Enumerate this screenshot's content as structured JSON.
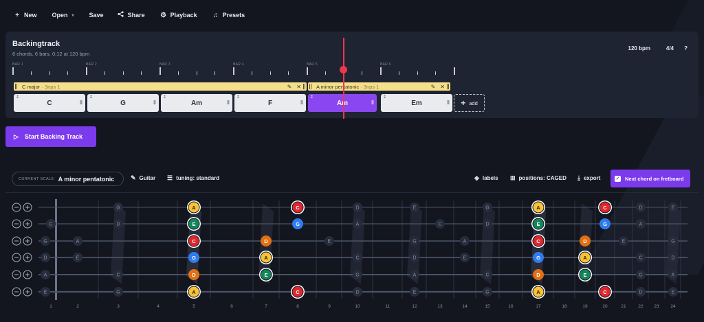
{
  "toolbar": {
    "new": "New",
    "open": "Open",
    "save": "Save",
    "share": "Share",
    "playback": "Playback",
    "presets": "Presets"
  },
  "backing_track": {
    "title": "Backingtrack",
    "subtitle": "6 chords, 6 bars, 0:12 at 120 bpm",
    "bpm": "120 bpm",
    "time_signature": "4/4",
    "help": "?",
    "bar_labels": [
      "BAR 1",
      "BAR 2",
      "BAR 3",
      "BAR 4",
      "BAR 5",
      "BAR 6"
    ],
    "scales": [
      {
        "name": "C major",
        "detail": "· 3nps 1"
      },
      {
        "name": "A minor pentatonic",
        "detail": "· 3nps 1"
      }
    ],
    "chords": [
      "C",
      "G",
      "Am",
      "F",
      "Am",
      "Em"
    ],
    "active_chord_index": 4,
    "add_label": "add"
  },
  "start_button": "Start Backing Track",
  "scale_toolbar": {
    "current_scale_label": "CURRENT SCALE",
    "current_scale": "A minor pentatonic",
    "instrument": "Guitar",
    "tuning": "tuning: standard",
    "labels": "labels",
    "positions": "positions: CAGED",
    "export": "export",
    "next_chord": "Next chord on fretboard"
  },
  "fretboard": {
    "open_strings": [
      "E",
      "B",
      "G",
      "D",
      "A",
      "E"
    ],
    "fret_numbers": [
      "1",
      "2",
      "3",
      "4",
      "5",
      "6",
      "7",
      "8",
      "9",
      "10",
      "11",
      "12",
      "13",
      "14",
      "15",
      "16",
      "17",
      "18",
      "19",
      "20",
      "21",
      "22",
      "23",
      "24"
    ],
    "note_colors": {
      "A": "#f7c236",
      "C": "#e0262f",
      "D": "#e36f13",
      "E": "#13855a",
      "G": "#2f7cf0"
    },
    "notes": [
      {
        "s": 0,
        "f": 3,
        "n": "G",
        "t": "ghost"
      },
      {
        "s": 0,
        "f": 5,
        "n": "A",
        "t": "root"
      },
      {
        "s": 0,
        "f": 8,
        "n": "C",
        "t": "root"
      },
      {
        "s": 0,
        "f": 10,
        "n": "D",
        "t": "ghost"
      },
      {
        "s": 0,
        "f": 12,
        "n": "E",
        "t": "ghost"
      },
      {
        "s": 0,
        "f": 15,
        "n": "G",
        "t": "ghost"
      },
      {
        "s": 0,
        "f": 17,
        "n": "A",
        "t": "root"
      },
      {
        "s": 0,
        "f": 20,
        "n": "C",
        "t": "root"
      },
      {
        "s": 0,
        "f": 22,
        "n": "D",
        "t": "ghost"
      },
      {
        "s": 0,
        "f": 24,
        "n": "E",
        "t": "ghost"
      },
      {
        "s": 1,
        "f": 1,
        "n": "C",
        "t": "ghost"
      },
      {
        "s": 1,
        "f": 3,
        "n": "D",
        "t": "ghost"
      },
      {
        "s": 1,
        "f": 5,
        "n": "E",
        "t": "root"
      },
      {
        "s": 1,
        "f": 8,
        "n": "G",
        "t": "note"
      },
      {
        "s": 1,
        "f": 10,
        "n": "A",
        "t": "ghost"
      },
      {
        "s": 1,
        "f": 13,
        "n": "C",
        "t": "ghost"
      },
      {
        "s": 1,
        "f": 15,
        "n": "D",
        "t": "ghost"
      },
      {
        "s": 1,
        "f": 17,
        "n": "E",
        "t": "root"
      },
      {
        "s": 1,
        "f": 20,
        "n": "G",
        "t": "note"
      },
      {
        "s": 1,
        "f": 22,
        "n": "A",
        "t": "ghost"
      },
      {
        "s": 2,
        "f": 0,
        "n": "G",
        "t": "ghost"
      },
      {
        "s": 2,
        "f": 2,
        "n": "A",
        "t": "ghost"
      },
      {
        "s": 2,
        "f": 5,
        "n": "C",
        "t": "root"
      },
      {
        "s": 2,
        "f": 7,
        "n": "D",
        "t": "note"
      },
      {
        "s": 2,
        "f": 9,
        "n": "E",
        "t": "ghost"
      },
      {
        "s": 2,
        "f": 12,
        "n": "G",
        "t": "ghost"
      },
      {
        "s": 2,
        "f": 14,
        "n": "A",
        "t": "ghost"
      },
      {
        "s": 2,
        "f": 17,
        "n": "C",
        "t": "root"
      },
      {
        "s": 2,
        "f": 19,
        "n": "D",
        "t": "note"
      },
      {
        "s": 2,
        "f": 21,
        "n": "E",
        "t": "ghost"
      },
      {
        "s": 2,
        "f": 24,
        "n": "G",
        "t": "ghost"
      },
      {
        "s": 3,
        "f": 0,
        "n": "D",
        "t": "ghost"
      },
      {
        "s": 3,
        "f": 2,
        "n": "E",
        "t": "ghost"
      },
      {
        "s": 3,
        "f": 5,
        "n": "G",
        "t": "note"
      },
      {
        "s": 3,
        "f": 7,
        "n": "A",
        "t": "root"
      },
      {
        "s": 3,
        "f": 10,
        "n": "C",
        "t": "ghost"
      },
      {
        "s": 3,
        "f": 12,
        "n": "D",
        "t": "ghost"
      },
      {
        "s": 3,
        "f": 14,
        "n": "E",
        "t": "ghost"
      },
      {
        "s": 3,
        "f": 17,
        "n": "G",
        "t": "note"
      },
      {
        "s": 3,
        "f": 19,
        "n": "A",
        "t": "root"
      },
      {
        "s": 3,
        "f": 22,
        "n": "C",
        "t": "ghost"
      },
      {
        "s": 3,
        "f": 24,
        "n": "D",
        "t": "ghost"
      },
      {
        "s": 4,
        "f": 0,
        "n": "A",
        "t": "ghost"
      },
      {
        "s": 4,
        "f": 3,
        "n": "C",
        "t": "ghost"
      },
      {
        "s": 4,
        "f": 5,
        "n": "D",
        "t": "note"
      },
      {
        "s": 4,
        "f": 7,
        "n": "E",
        "t": "root"
      },
      {
        "s": 4,
        "f": 10,
        "n": "G",
        "t": "ghost"
      },
      {
        "s": 4,
        "f": 12,
        "n": "A",
        "t": "ghost"
      },
      {
        "s": 4,
        "f": 15,
        "n": "C",
        "t": "ghost"
      },
      {
        "s": 4,
        "f": 17,
        "n": "D",
        "t": "note"
      },
      {
        "s": 4,
        "f": 19,
        "n": "E",
        "t": "root"
      },
      {
        "s": 4,
        "f": 22,
        "n": "G",
        "t": "ghost"
      },
      {
        "s": 4,
        "f": 24,
        "n": "A",
        "t": "ghost"
      },
      {
        "s": 5,
        "f": 0,
        "n": "E",
        "t": "ghost"
      },
      {
        "s": 5,
        "f": 3,
        "n": "G",
        "t": "ghost"
      },
      {
        "s": 5,
        "f": 5,
        "n": "A",
        "t": "root"
      },
      {
        "s": 5,
        "f": 8,
        "n": "C",
        "t": "root"
      },
      {
        "s": 5,
        "f": 10,
        "n": "D",
        "t": "ghost"
      },
      {
        "s": 5,
        "f": 12,
        "n": "E",
        "t": "ghost"
      },
      {
        "s": 5,
        "f": 15,
        "n": "G",
        "t": "ghost"
      },
      {
        "s": 5,
        "f": 17,
        "n": "A",
        "t": "root"
      },
      {
        "s": 5,
        "f": 20,
        "n": "C",
        "t": "root"
      },
      {
        "s": 5,
        "f": 22,
        "n": "D",
        "t": "ghost"
      },
      {
        "s": 5,
        "f": 24,
        "n": "E",
        "t": "ghost"
      }
    ]
  }
}
